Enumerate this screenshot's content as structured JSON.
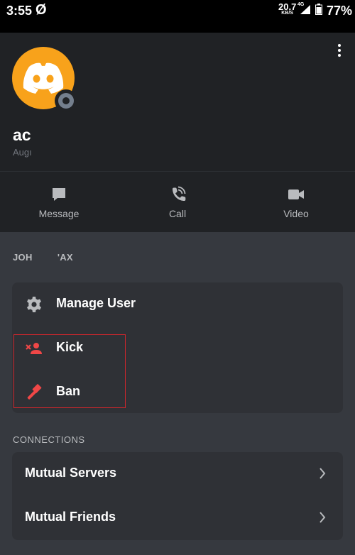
{
  "status_bar": {
    "time": "3:55",
    "phi_glyph": "Ø",
    "net_speed": "20.7",
    "net_unit": "KB/S",
    "network": "4G",
    "battery": "77%"
  },
  "profile": {
    "username": "ac",
    "subtext": "Augı",
    "avatar_color": "#f8a21b",
    "status_color": "#747f8d"
  },
  "actions": [
    {
      "label": "Message",
      "icon": "message-icon"
    },
    {
      "label": "Call",
      "icon": "call-icon"
    },
    {
      "label": "Video",
      "icon": "video-icon"
    }
  ],
  "roles_section": {
    "label": "JOH         'AX"
  },
  "moderation": {
    "items": [
      {
        "label": "Manage User",
        "icon": "gear-icon"
      },
      {
        "label": "Kick",
        "icon": "kick-user-icon",
        "color": "#f04747"
      },
      {
        "label": "Ban",
        "icon": "hammer-icon",
        "color": "#f04747"
      }
    ]
  },
  "connections": {
    "label": "CONNECTIONS",
    "items": [
      {
        "label": "Mutual Servers"
      },
      {
        "label": "Mutual Friends"
      }
    ]
  }
}
